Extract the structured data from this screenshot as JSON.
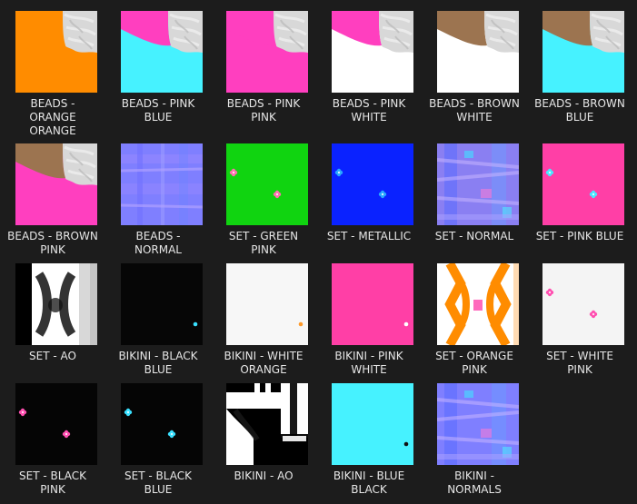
{
  "items": [
    {
      "label": "BEADS -\nORANGE\nORANGE",
      "thumb": "beads",
      "colors": [
        "#ff8c00",
        "#ff8c00"
      ]
    },
    {
      "label": "BEADS - PINK\nBLUE",
      "thumb": "beads",
      "colors": [
        "#ff3fbf",
        "#46f2ff"
      ]
    },
    {
      "label": "BEADS - PINK\nPINK",
      "thumb": "beads",
      "colors": [
        "#ff3fbf",
        "#ff3fbf"
      ]
    },
    {
      "label": "BEADS - PINK\nWHITE",
      "thumb": "beads",
      "colors": [
        "#ff3fbf",
        "#ffffff"
      ]
    },
    {
      "label": "BEADS - BROWN\nWHITE",
      "thumb": "beads",
      "colors": [
        "#9c7450",
        "#ffffff"
      ]
    },
    {
      "label": "BEADS - BROWN\nBLUE",
      "thumb": "beads",
      "colors": [
        "#9c7450",
        "#46f2ff"
      ]
    },
    {
      "label": "BEADS - BROWN\nPINK",
      "thumb": "beads",
      "colors": [
        "#9c7450",
        "#ff3fbf"
      ]
    },
    {
      "label": "BEADS -\nNORMAL",
      "thumb": "normal",
      "colors": [
        "#7f7fff",
        "#9a8aff"
      ]
    },
    {
      "label": "SET - GREEN\nPINK",
      "thumb": "flowers",
      "colors": [
        "#10d410",
        "#ff6fb0"
      ]
    },
    {
      "label": "SET - METALLIC",
      "thumb": "flowers",
      "colors": [
        "#0a22ff",
        "#28a8ff"
      ]
    },
    {
      "label": "SET - NORMAL",
      "thumb": "normal-complex",
      "colors": [
        "#8a7ff2",
        "#aaa0ff"
      ]
    },
    {
      "label": "SET - PINK BLUE",
      "thumb": "flowers",
      "colors": [
        "#ff3fa6",
        "#48e6ff"
      ]
    },
    {
      "label": "SET - AO",
      "thumb": "ao",
      "colors": [
        "#ffffff",
        "#000000"
      ]
    },
    {
      "label": "BIKINI - BLACK\nBLUE",
      "thumb": "dot",
      "colors": [
        "#060606",
        "#39e0ff"
      ]
    },
    {
      "label": "BIKINI - WHITE\nORANGE",
      "thumb": "dot",
      "colors": [
        "#f7f7f7",
        "#ff9a2a"
      ]
    },
    {
      "label": "BIKINI - PINK\nWHITE",
      "thumb": "dot",
      "colors": [
        "#ff3fa6",
        "#ffffff"
      ]
    },
    {
      "label": "SET - ORANGE\nPINK",
      "thumb": "orange-set",
      "colors": [
        "#ff8c00",
        "#ff4fb0"
      ]
    },
    {
      "label": "SET - WHITE\nPINK",
      "thumb": "flowers",
      "colors": [
        "#f4f4f4",
        "#ff4fb0"
      ]
    },
    {
      "label": "SET - BLACK\nPINK",
      "thumb": "flowers",
      "colors": [
        "#050505",
        "#ff4fb0"
      ]
    },
    {
      "label": "SET - BLACK\nBLUE",
      "thumb": "flowers",
      "colors": [
        "#050505",
        "#39e0ff"
      ]
    },
    {
      "label": "BIKINI - AO",
      "thumb": "bikini-ao",
      "colors": [
        "#ffffff",
        "#000000"
      ]
    },
    {
      "label": "BIKINI - BLUE\nBLACK",
      "thumb": "dot",
      "colors": [
        "#46f2ff",
        "#111111"
      ]
    },
    {
      "label": "BIKINI -\nNORMALS",
      "thumb": "normal-complex",
      "colors": [
        "#7f7fff",
        "#a9a0ff"
      ]
    }
  ]
}
